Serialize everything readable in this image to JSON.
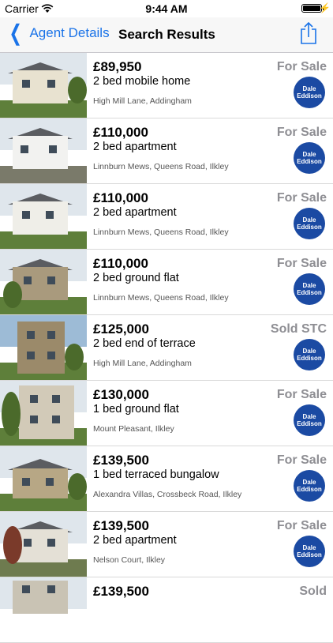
{
  "statusbar": {
    "carrier": "Carrier",
    "time": "9:44 AM"
  },
  "nav": {
    "back_label": "Agent Details",
    "title": "Search Results"
  },
  "listings": [
    {
      "price": "£89,950",
      "desc": "2 bed mobile home",
      "address": "High Mill Lane, Addingham",
      "status": "For Sale"
    },
    {
      "price": "£110,000",
      "desc": "2 bed apartment",
      "address": "Linnburn Mews, Queens Road, Ilkley",
      "status": "For Sale"
    },
    {
      "price": "£110,000",
      "desc": "2 bed apartment",
      "address": "Linnburn Mews, Queens Road, Ilkley",
      "status": "For Sale"
    },
    {
      "price": "£110,000",
      "desc": "2 bed ground flat",
      "address": "Linnburn Mews, Queens Road, Ilkley",
      "status": "For Sale"
    },
    {
      "price": "£125,000",
      "desc": "2 bed end of terrace",
      "address": "High Mill Lane, Addingham",
      "status": "Sold STC"
    },
    {
      "price": "£130,000",
      "desc": "1 bed ground flat",
      "address": "Mount Pleasant, Ilkley",
      "status": "For Sale"
    },
    {
      "price": "£139,500",
      "desc": "1 bed terraced bungalow",
      "address": "Alexandra Villas, Crossbeck Road, Ilkley",
      "status": "For Sale"
    },
    {
      "price": "£139,500",
      "desc": "2 bed apartment",
      "address": "Nelson Court, Ilkley",
      "status": "For Sale"
    },
    {
      "price": "£139,500",
      "desc": "",
      "address": "",
      "status": "Sold"
    }
  ],
  "agent_logo": {
    "line1": "Dale",
    "line2": "Eddison"
  },
  "colors": {
    "accent": "#1a73e8",
    "logo": "#1b4aa3",
    "status_text": "#8e8e93"
  }
}
